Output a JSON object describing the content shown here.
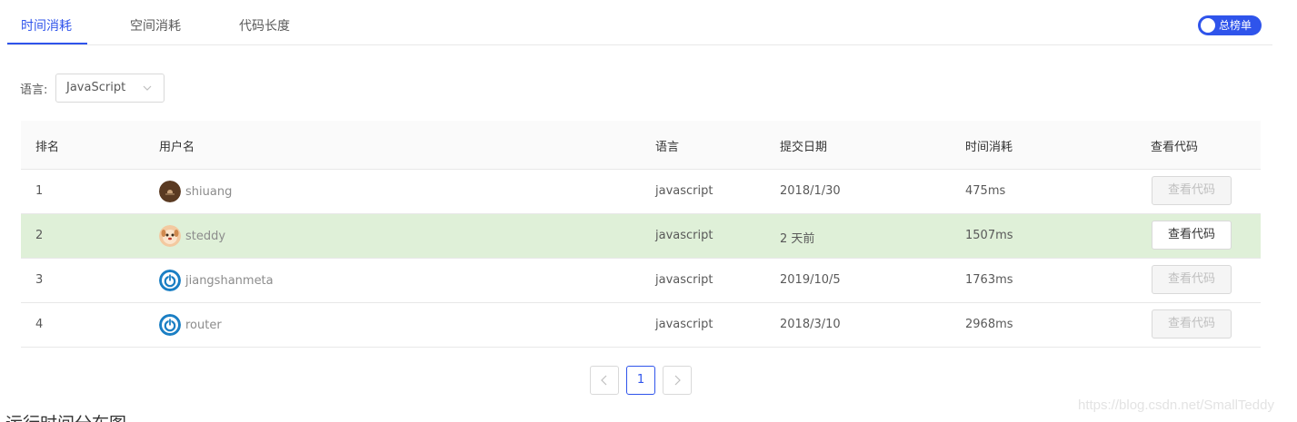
{
  "tabs": [
    {
      "label": "时间消耗",
      "active": true
    },
    {
      "label": "空间消耗",
      "active": false
    },
    {
      "label": "代码长度",
      "active": false
    }
  ],
  "toggle": {
    "label": "总榜单",
    "on": true
  },
  "filter": {
    "label": "语言:",
    "value": "JavaScript"
  },
  "table": {
    "headers": [
      "排名",
      "用户名",
      "语言",
      "提交日期",
      "时间消耗",
      "查看代码"
    ],
    "rows": [
      {
        "rank": "1",
        "user": "shiuang",
        "avatar": "brown-avatar-icon",
        "lang": "javascript",
        "date": "2018/1/30",
        "time": "475ms",
        "button": "查看代码",
        "button_enabled": false,
        "highlight": false
      },
      {
        "rank": "2",
        "user": "steddy",
        "avatar": "dog-avatar-icon",
        "lang": "javascript",
        "date": "2 天前",
        "time": "1507ms",
        "button": "查看代码",
        "button_enabled": true,
        "highlight": true
      },
      {
        "rank": "3",
        "user": "jiangshanmeta",
        "avatar": "power-avatar-icon",
        "lang": "javascript",
        "date": "2019/10/5",
        "time": "1763ms",
        "button": "查看代码",
        "button_enabled": false,
        "highlight": false
      },
      {
        "rank": "4",
        "user": "router",
        "avatar": "power-avatar-icon",
        "lang": "javascript",
        "date": "2018/3/10",
        "time": "2968ms",
        "button": "查看代码",
        "button_enabled": false,
        "highlight": false
      }
    ]
  },
  "pagination": {
    "current": "1"
  },
  "watermark": "https://blog.csdn.net/SmallTeddy",
  "section_title": "运行时间分布图",
  "colors": {
    "accent": "#2f54eb",
    "highlight_row": "#dff0d8"
  }
}
